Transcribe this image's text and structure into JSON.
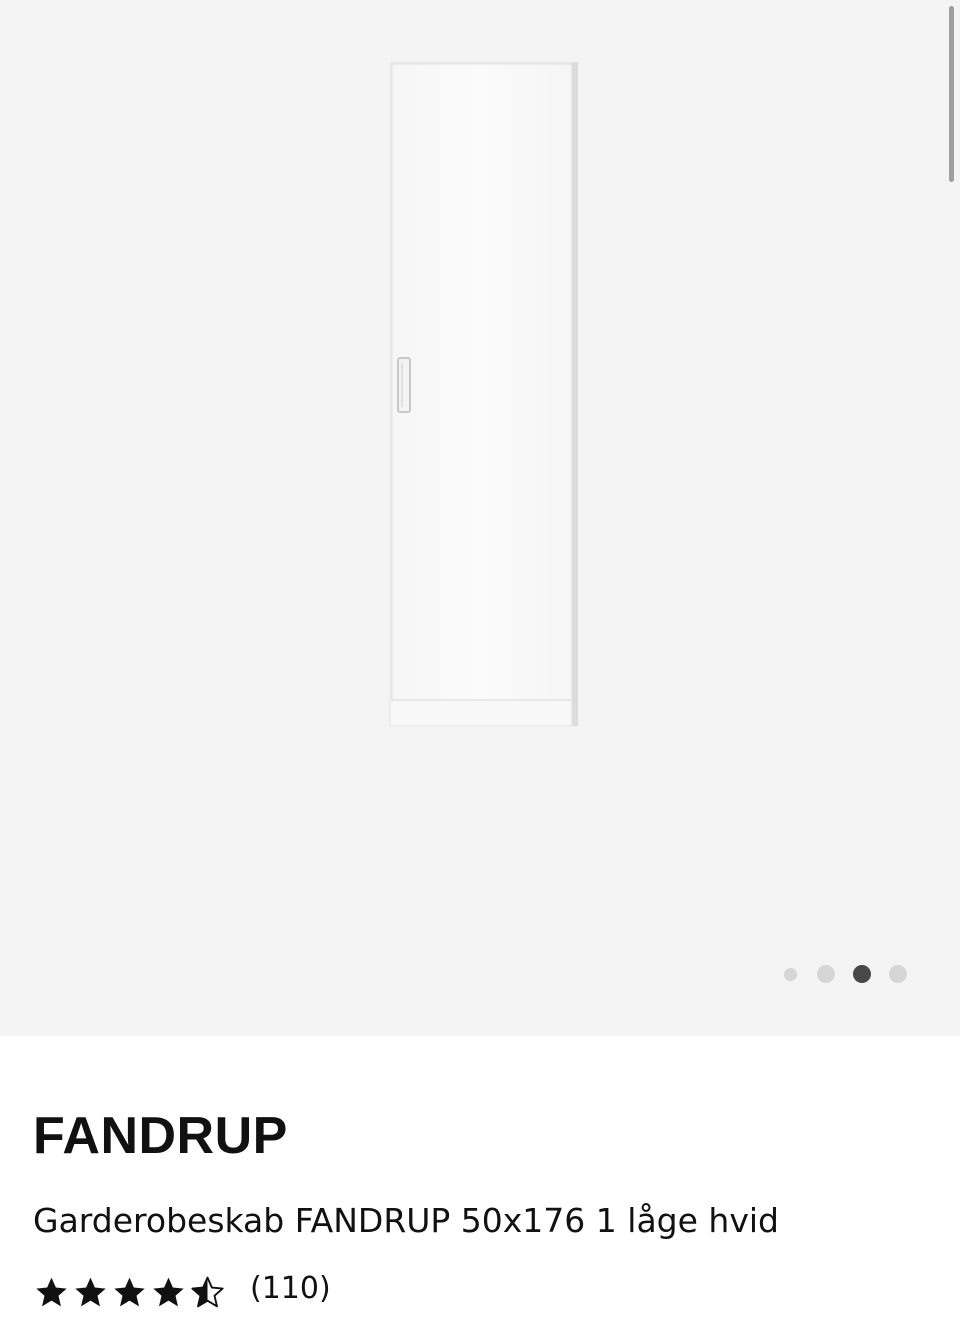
{
  "gallery": {
    "total_images": 4,
    "active_index": 2,
    "dot_colors": {
      "inactive": "#d6d6d6",
      "active": "#484848"
    },
    "background": "#f4f4f4"
  },
  "product": {
    "brand": "FANDRUP",
    "description": "Garderobeskab FANDRUP 50x176 1 låge hvid",
    "rating": {
      "value": 4.5,
      "max": 5,
      "count_label": "(110)",
      "icons": [
        "star-full-icon",
        "star-full-icon",
        "star-full-icon",
        "star-full-icon",
        "star-half-icon"
      ]
    }
  }
}
